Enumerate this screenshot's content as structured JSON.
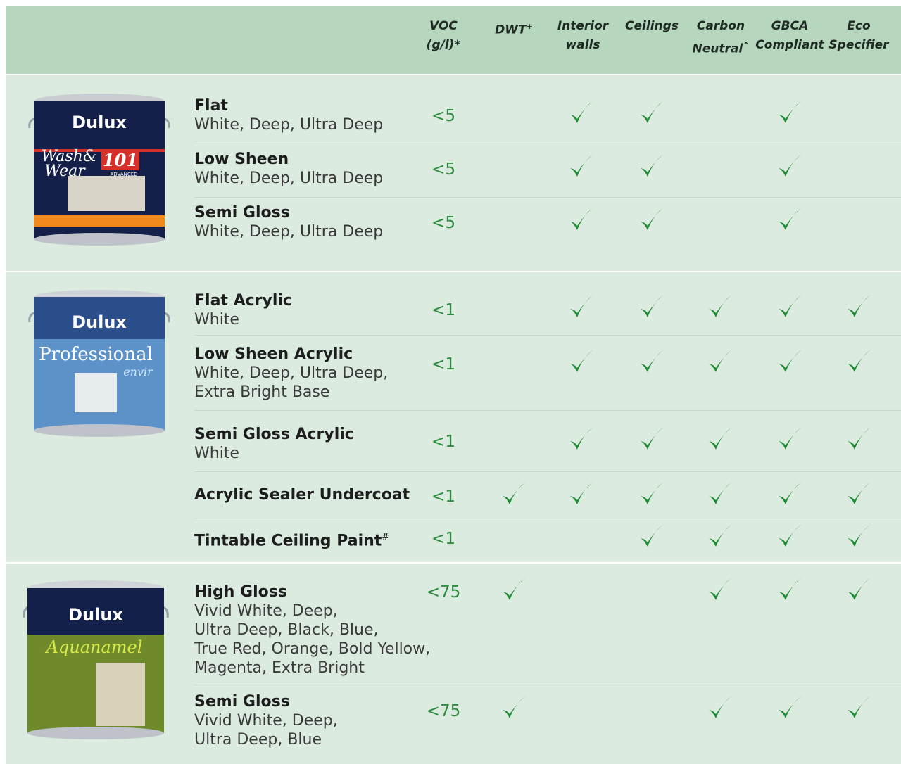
{
  "header": {
    "columns": [
      {
        "id": "voc",
        "label": "VOC (g/l)*"
      },
      {
        "id": "dwt",
        "label": "DWT",
        "sup": "+"
      },
      {
        "id": "interior",
        "label": "Interior\nwalls"
      },
      {
        "id": "ceilings",
        "label": "Ceilings"
      },
      {
        "id": "carbon",
        "label": "Carbon\nNeutral",
        "sup": "^"
      },
      {
        "id": "gbca",
        "label": "GBCA\nCompliant"
      },
      {
        "id": "eco",
        "label": "Eco\nSpecifier"
      }
    ]
  },
  "tick_color": "#1f8b33",
  "cans": [
    {
      "brand": "Dulux",
      "line1": "Wash&",
      "line2": "Wear",
      "badge": "101",
      "sub": "ADVANCED",
      "label_color": "#15204a"
    },
    {
      "brand": "Dulux",
      "line1": "Professional",
      "line2": "envir",
      "label_color": "#2a4f8a"
    },
    {
      "brand": "Dulux",
      "line1": "Aquanamel",
      "label_color": "#13204a"
    }
  ],
  "products": [
    {
      "name": "Flat",
      "colors": "White, Deep, Ultra Deep",
      "voc": "<5",
      "dwt": false,
      "interior": true,
      "ceilings": true,
      "carbon": false,
      "gbca": true,
      "eco": false
    },
    {
      "name": "Low Sheen",
      "colors": "White, Deep, Ultra Deep",
      "voc": "<5",
      "dwt": false,
      "interior": true,
      "ceilings": true,
      "carbon": false,
      "gbca": true,
      "eco": false
    },
    {
      "name": "Semi Gloss",
      "colors": "White, Deep, Ultra Deep",
      "voc": "<5",
      "dwt": false,
      "interior": true,
      "ceilings": true,
      "carbon": false,
      "gbca": true,
      "eco": false
    },
    {
      "name": "Flat Acrylic",
      "colors": "White",
      "voc": "<1",
      "dwt": false,
      "interior": true,
      "ceilings": true,
      "carbon": true,
      "gbca": true,
      "eco": true
    },
    {
      "name": "Low Sheen Acrylic",
      "colors": "White, Deep, Ultra Deep,\nExtra Bright Base",
      "voc": "<1",
      "dwt": false,
      "interior": true,
      "ceilings": true,
      "carbon": true,
      "gbca": true,
      "eco": true
    },
    {
      "name": "Semi Gloss Acrylic",
      "colors": "White",
      "voc": "<1",
      "dwt": false,
      "interior": true,
      "ceilings": true,
      "carbon": true,
      "gbca": true,
      "eco": true
    },
    {
      "name": "Acrylic Sealer Undercoat",
      "colors": "",
      "voc": "<1",
      "dwt": true,
      "interior": true,
      "ceilings": true,
      "carbon": true,
      "gbca": true,
      "eco": true
    },
    {
      "name": "Tintable Ceiling Paint",
      "sup": "#",
      "colors": "",
      "voc": "<1",
      "dwt": false,
      "interior": false,
      "ceilings": true,
      "carbon": true,
      "gbca": true,
      "eco": true
    },
    {
      "name": "High Gloss",
      "colors": "Vivid White, Deep,\nUltra Deep, Black, Blue,\nTrue Red, Orange, Bold Yellow,\nMagenta, Extra Bright",
      "voc": "<75",
      "dwt": true,
      "interior": false,
      "ceilings": false,
      "carbon": true,
      "gbca": true,
      "eco": true
    },
    {
      "name": "Semi Gloss",
      "colors": "Vivid White, Deep,\nUltra Deep, Blue",
      "voc": "<75",
      "dwt": true,
      "interior": false,
      "ceilings": false,
      "carbon": true,
      "gbca": true,
      "eco": true
    }
  ]
}
